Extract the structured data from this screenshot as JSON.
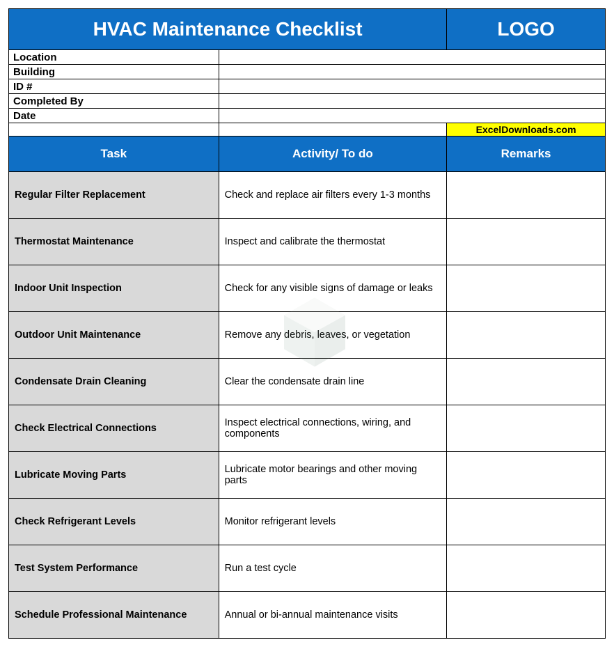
{
  "title": "HVAC Maintenance Checklist",
  "logo_text": "LOGO",
  "info_fields": {
    "location": {
      "label": "Location",
      "value": ""
    },
    "building": {
      "label": "Building",
      "value": ""
    },
    "id": {
      "label": "ID #",
      "value": ""
    },
    "completed_by": {
      "label": "Completed By",
      "value": ""
    },
    "date": {
      "label": "Date",
      "value": ""
    }
  },
  "attribution": "ExcelDownloads.com",
  "columns": {
    "task": "Task",
    "activity": "Activity/ To do",
    "remarks": "Remarks"
  },
  "rows": [
    {
      "task": "Regular Filter Replacement",
      "activity": "Check and replace air filters every 1-3 months",
      "remarks": ""
    },
    {
      "task": "Thermostat Maintenance",
      "activity": "Inspect and calibrate the thermostat",
      "remarks": ""
    },
    {
      "task": "Indoor Unit Inspection",
      "activity": "Check for any visible signs of damage or leaks",
      "remarks": ""
    },
    {
      "task": "Outdoor Unit Maintenance",
      "activity": "Remove any debris, leaves, or vegetation",
      "remarks": ""
    },
    {
      "task": "Condensate Drain Cleaning",
      "activity": "Clear the condensate drain line",
      "remarks": ""
    },
    {
      "task": "Check Electrical Connections",
      "activity": "Inspect electrical connections, wiring, and components",
      "remarks": ""
    },
    {
      "task": "Lubricate Moving Parts",
      "activity": "Lubricate motor bearings and other moving parts",
      "remarks": ""
    },
    {
      "task": "Check Refrigerant Levels",
      "activity": "Monitor refrigerant levels",
      "remarks": ""
    },
    {
      "task": "Test System Performance",
      "activity": "Run a test cycle",
      "remarks": ""
    },
    {
      "task": "Schedule Professional Maintenance",
      "activity": "Annual or bi-annual maintenance visits",
      "remarks": ""
    }
  ]
}
